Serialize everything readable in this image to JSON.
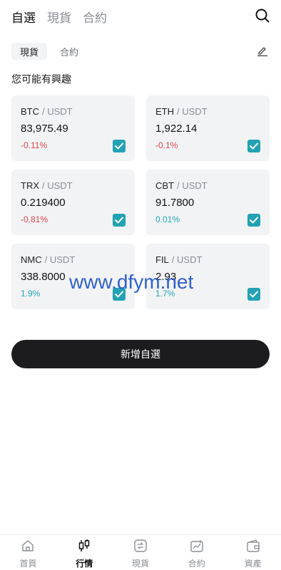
{
  "top_tabs": [
    {
      "label": "自選",
      "active": true
    },
    {
      "label": "現貨",
      "active": false
    },
    {
      "label": "合約",
      "active": false
    }
  ],
  "sub_tabs": [
    {
      "label": "現貨",
      "active": true
    },
    {
      "label": "合約",
      "active": false
    }
  ],
  "section_title": "您可能有興趣",
  "cards": [
    {
      "base": "BTC",
      "quote": "/ USDT",
      "price": "83,975.49",
      "change": "-0.11%",
      "direction": "down",
      "checked": true
    },
    {
      "base": "ETH",
      "quote": "/ USDT",
      "price": "1,922.14",
      "change": "-0.1%",
      "direction": "down",
      "checked": true
    },
    {
      "base": "TRX",
      "quote": "/ USDT",
      "price": "0.219400",
      "change": "-0.81%",
      "direction": "down",
      "checked": true
    },
    {
      "base": "CBT",
      "quote": "/ USDT",
      "price": "91.7800",
      "change": "0.01%",
      "direction": "up",
      "checked": true
    },
    {
      "base": "NMC",
      "quote": "/ USDT",
      "price": "338.8000",
      "change": "1.9%",
      "direction": "up",
      "checked": true
    },
    {
      "base": "FIL",
      "quote": "/ USDT",
      "price": "2.93",
      "change": "1.7%",
      "direction": "up",
      "checked": true
    }
  ],
  "add_button_label": "新增自選",
  "watermark": "www.dfym.net",
  "bottom_nav": [
    {
      "label": "首頁",
      "icon": "home-icon",
      "active": false
    },
    {
      "label": "行情",
      "icon": "market-candle-icon",
      "active": true
    },
    {
      "label": "現貨",
      "icon": "spot-exchange-icon",
      "active": false
    },
    {
      "label": "合約",
      "icon": "contract-chart-icon",
      "active": false
    },
    {
      "label": "資產",
      "icon": "wallet-icon",
      "active": false
    }
  ],
  "colors": {
    "accent": "#23a2b3",
    "negative": "#e0454d",
    "positive": "#23a6b5",
    "card_bg": "#f2f3f5",
    "button_bg": "#1c1c1e"
  }
}
